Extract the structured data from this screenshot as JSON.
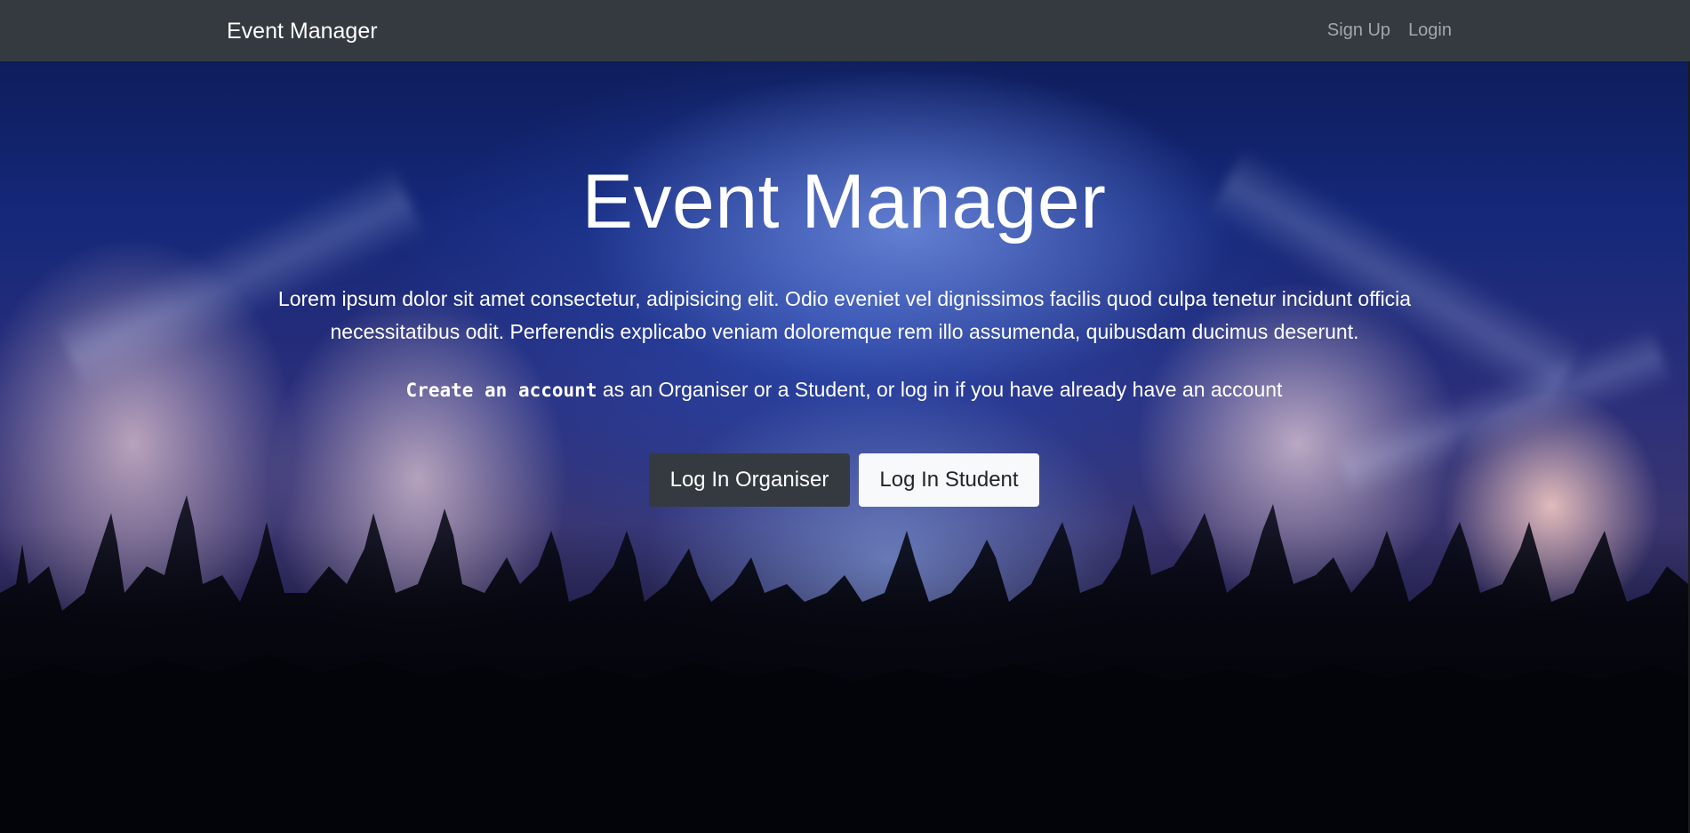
{
  "navbar": {
    "brand": "Event Manager",
    "links": [
      "Sign Up",
      "Login"
    ]
  },
  "hero": {
    "title": "Event Manager",
    "lead": "Lorem ipsum dolor sit amet consectetur, adipisicing elit. Odio eveniet vel dignissimos facilis quod culpa tenetur incidunt officia necessitatibus odit. Perferendis explicabo veniam doloremque rem illo assumenda, quibusdam ducimus deserunt.",
    "cta_code": "Create an account",
    "cta_text": " as an Organiser or a Student, or log in if you have already have an account",
    "buttons": {
      "organiser": "Log In Organiser",
      "student": "Log In Student"
    }
  },
  "colors": {
    "navbar_bg": "#343a40",
    "btn_dark": "#343a40",
    "btn_light": "#f8f9fa",
    "nav_link": "rgba(255,255,255,0.55)"
  }
}
